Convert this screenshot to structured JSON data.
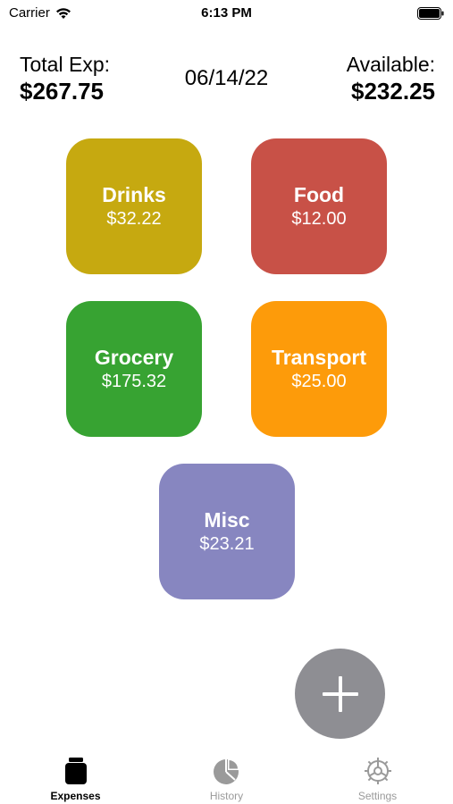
{
  "status_bar": {
    "carrier": "Carrier",
    "time": "6:13 PM"
  },
  "summary": {
    "total_label": "Total Exp:",
    "total_value": "$267.75",
    "date": "06/14/22",
    "available_label": "Available:",
    "available_value": "$232.25"
  },
  "categories": [
    {
      "name": "Drinks",
      "amount": "$32.22",
      "color": "#c6a910"
    },
    {
      "name": "Food",
      "amount": "$12.00",
      "color": "#c85147"
    },
    {
      "name": "Grocery",
      "amount": "$175.32",
      "color": "#37a332"
    },
    {
      "name": "Transport",
      "amount": "$25.00",
      "color": "#fd9b0a"
    },
    {
      "name": "Misc",
      "amount": "$23.21",
      "color": "#8786c0"
    }
  ],
  "add_button": {
    "icon": "plus-icon",
    "color": "#8e8e93"
  },
  "tab_bar": {
    "tabs": [
      {
        "label": "Expenses",
        "icon": "jar-icon",
        "active": true
      },
      {
        "label": "History",
        "icon": "pie-chart-icon",
        "active": false
      },
      {
        "label": "Settings",
        "icon": "gear-icon",
        "active": false
      }
    ]
  }
}
